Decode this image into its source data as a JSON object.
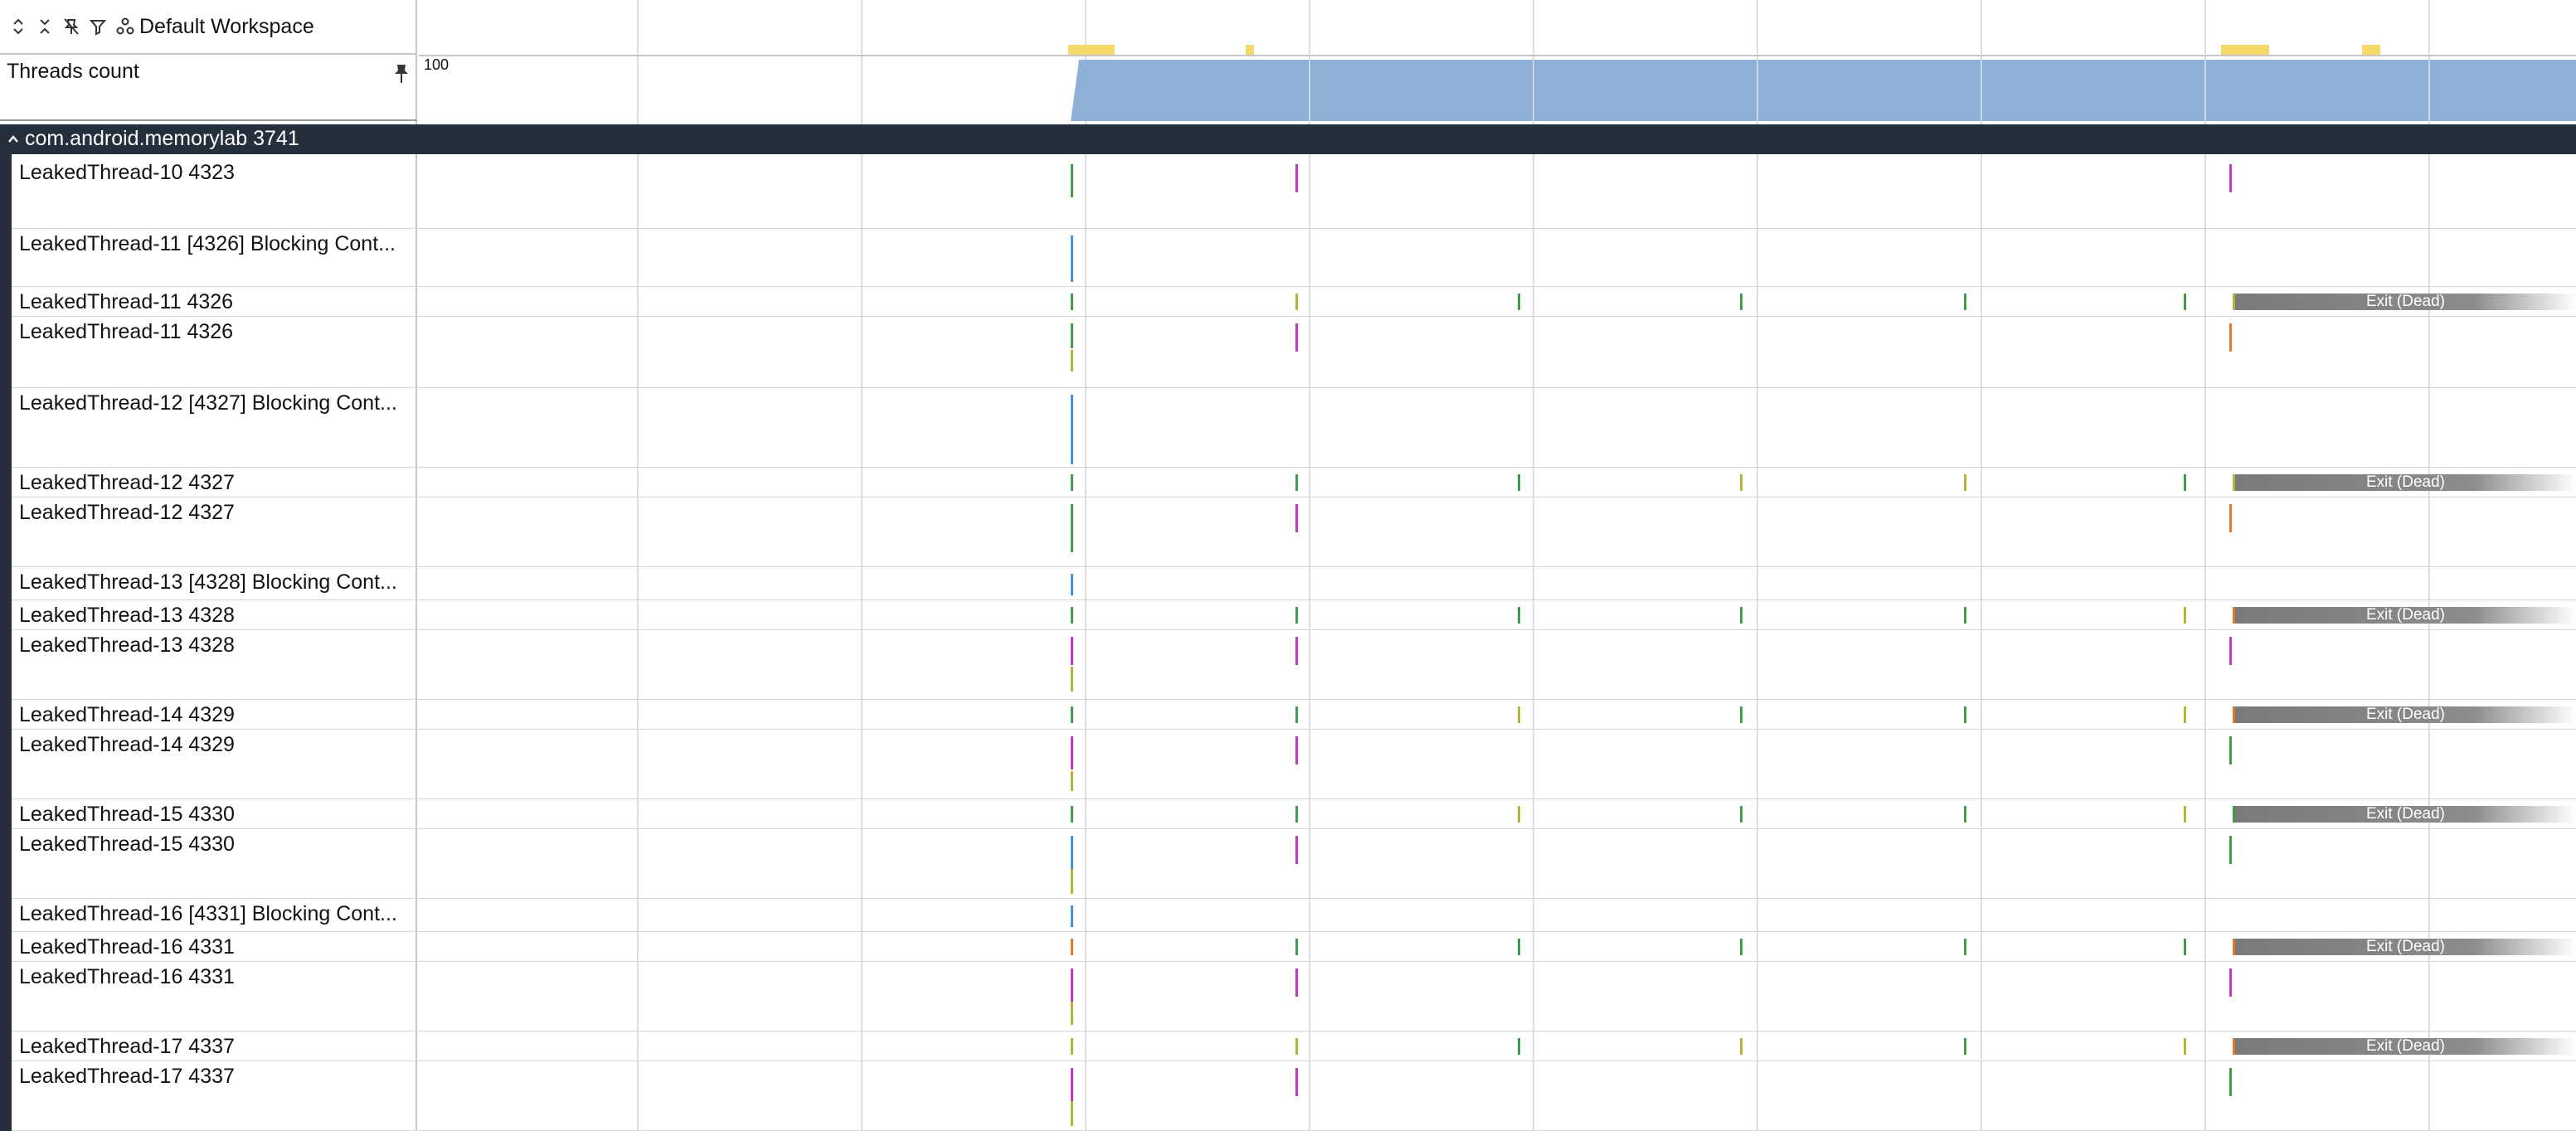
{
  "toolbar": {
    "workspace_label": "Default Workspace"
  },
  "pinned": {
    "track_title": "Threads count",
    "max_label": "100"
  },
  "process": {
    "label": "com.android.memorylab 3741"
  },
  "threads": [
    {
      "label": "LeakedThread-10 4323"
    },
    {
      "label": "LeakedThread-11 [4326] Blocking Cont..."
    },
    {
      "label": "LeakedThread-11 4326",
      "state": "Exit (Dead)"
    },
    {
      "label": "LeakedThread-11 4326"
    },
    {
      "label": "LeakedThread-12 [4327] Blocking Cont..."
    },
    {
      "label": "LeakedThread-12 4327",
      "state": "Exit (Dead)"
    },
    {
      "label": "LeakedThread-12 4327"
    },
    {
      "label": "LeakedThread-13 [4328] Blocking Cont..."
    },
    {
      "label": "LeakedThread-13 4328",
      "state": "Exit (Dead)"
    },
    {
      "label": "LeakedThread-13 4328"
    },
    {
      "label": "LeakedThread-14 4329",
      "state": "Exit (Dead)"
    },
    {
      "label": "LeakedThread-14 4329"
    },
    {
      "label": "LeakedThread-15 4330",
      "state": "Exit (Dead)"
    },
    {
      "label": "LeakedThread-15 4330"
    },
    {
      "label": "LeakedThread-16 [4331] Blocking Cont..."
    },
    {
      "label": "LeakedThread-16 4331",
      "state": "Exit (Dead)"
    },
    {
      "label": "LeakedThread-16 4331"
    },
    {
      "label": "LeakedThread-17 4337",
      "state": "Exit (Dead)"
    },
    {
      "label": "LeakedThread-17 4337"
    }
  ],
  "colors": {
    "process_header": "#262f3c",
    "counter_fill": "#8eb0d6",
    "ruler_marker": "#f5d96b",
    "dead_state": "#8c8c8c",
    "slice_green": "#3f9b48",
    "slice_magenta": "#c438c8",
    "slice_blue": "#4a90e2",
    "slice_olive": "#b5b53a",
    "slice_orange": "#e07a2a"
  },
  "icons": [
    "expand-all-icon",
    "collapse-all-icon",
    "unpin-icon",
    "filter-icon",
    "workspace-icon",
    "pin-icon",
    "chevron-up-icon"
  ]
}
